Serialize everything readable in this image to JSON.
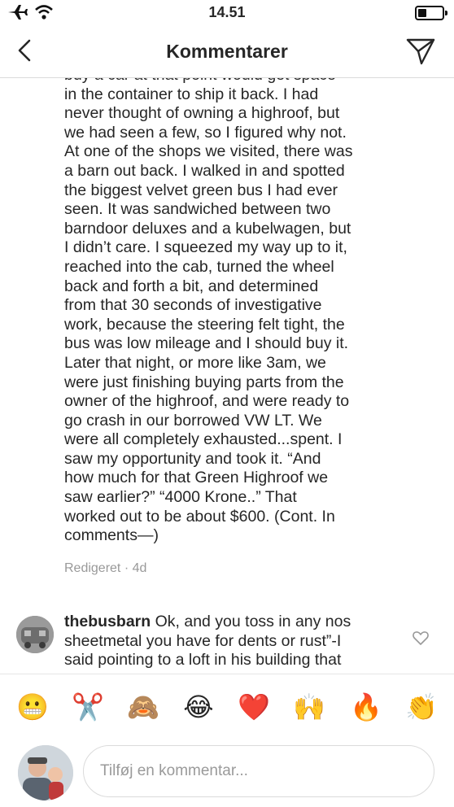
{
  "status": {
    "time": "14.51"
  },
  "header": {
    "title": "Kommentarer",
    "back_icon": "chevron-left-icon",
    "send_icon": "paper-plane-icon"
  },
  "caption": {
    "lines": [
      "buy a car at that point would get space",
      "in the container to ship it back. I had",
      "never thought of owning a highroof, but",
      "we had seen a few, so I figured why not.",
      "At one of the shops we visited, there was",
      "a barn out back. I walked in and spotted",
      "the biggest velvet green bus I had ever",
      "seen. It was sandwiched between two",
      "barndoor deluxes and a kubelwagen, but",
      "I didn’t care. I squeezed my way up to it,",
      "reached into the cab, turned the wheel",
      "back and forth a bit, and determined",
      "from that 30 seconds of investigative",
      "work, because the steering felt tight, the",
      "bus was low mileage and I should buy it.",
      "Later that night, or more like 3am, we",
      "were just finishing buying parts from the",
      "owner of the highroof, and were ready to",
      "go crash in our borrowed VW LT. We",
      "were all completely exhausted...spent. I",
      "saw my opportunity and took it. “And",
      "how much for that Green Highroof we",
      "saw earlier?” “4000 Krone..” That",
      "worked out to be about $600. (Cont. In",
      "comments—)"
    ],
    "meta": "Redigeret · 4d"
  },
  "comment": {
    "username": "thebusbarn",
    "line1": " Ok, and you toss in any nos",
    "line2": "sheetmetal you have for dents or rust”-I",
    "line3": "said pointing to a loft in his building that"
  },
  "emoji_bar": [
    {
      "char": "😬",
      "name": "grimacing-face-emoji"
    },
    {
      "char": "✂️",
      "name": "scissors-emoji"
    },
    {
      "char": "🙈",
      "name": "see-no-evil-monkey-emoji"
    },
    {
      "char": "😂",
      "name": "tears-of-joy-emoji"
    },
    {
      "char": "❤️",
      "name": "red-heart-emoji"
    },
    {
      "char": "🙌",
      "name": "raising-hands-emoji"
    },
    {
      "char": "🔥",
      "name": "fire-emoji"
    },
    {
      "char": "👏",
      "name": "clapping-hands-emoji"
    }
  ],
  "input": {
    "placeholder": "Tilføj en kommentar..."
  }
}
